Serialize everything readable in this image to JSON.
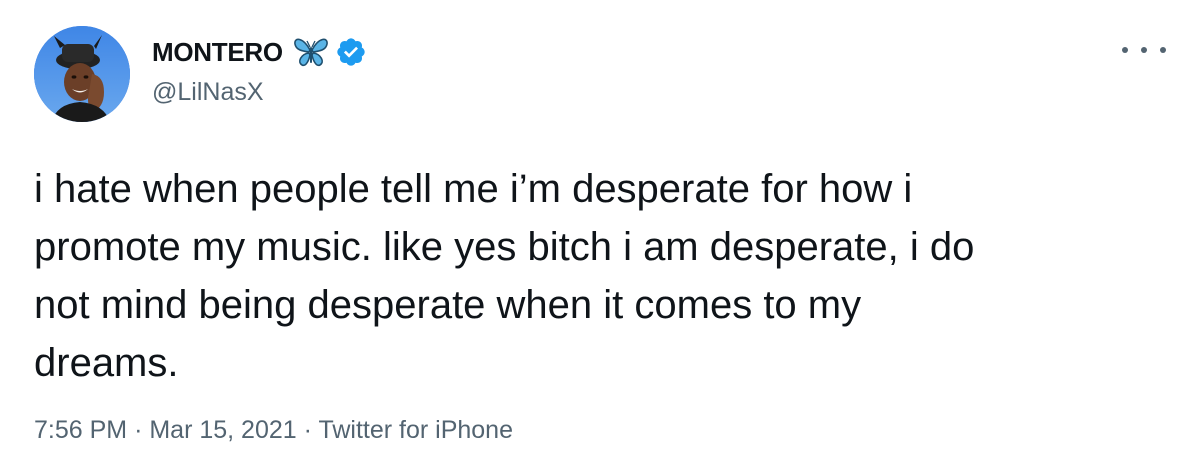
{
  "author": {
    "display_name": "MONTERO",
    "handle": "@LilNasX",
    "name_emoji_icon": "butterfly-icon",
    "verified_icon": "verified-badge-icon",
    "verified_color": "#1d9bf0"
  },
  "tweet": {
    "text_lines": [
      "i hate when people tell me i’m desperate for how i",
      "promote my music. like yes bitch i am desperate, i do",
      "not mind being desperate when it comes to my",
      "dreams."
    ]
  },
  "meta": {
    "time": "7:56 PM",
    "separator": "·",
    "date": "Mar 15, 2021",
    "source": "Twitter for iPhone"
  },
  "more_icon": "more-horizontal-icon"
}
